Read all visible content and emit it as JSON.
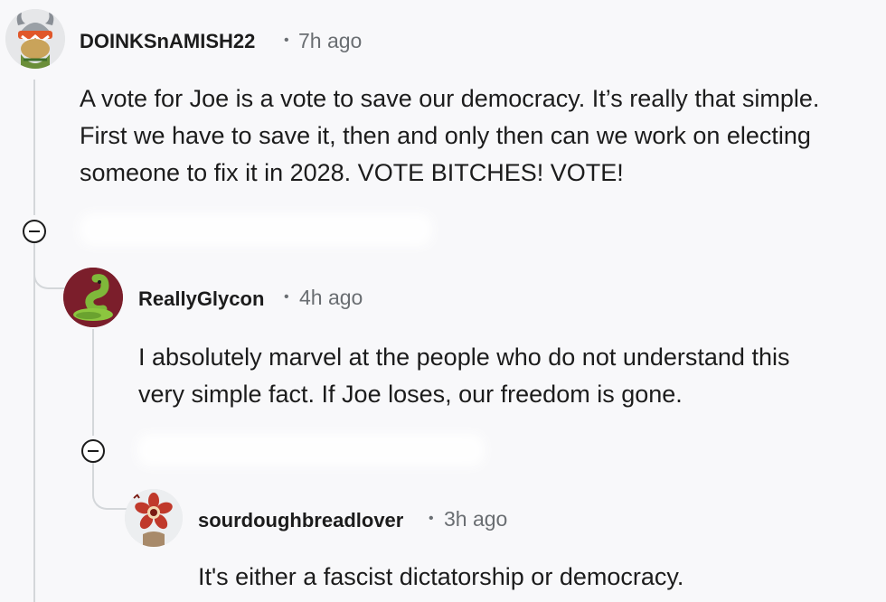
{
  "comments": [
    {
      "username": "DOINKSnAMISH22",
      "separator": "•",
      "time": "7h ago",
      "lines": [
        "A vote for Joe is a vote to save our democracy. It’s really that simple.",
        "First we have to save it, then and only then can we work on electing",
        "someone to fix it in 2028. VOTE BITCHES! VOTE!"
      ],
      "avatar_icon": "viking-snoo-avatar-icon"
    },
    {
      "username": "ReallyGlycon",
      "separator": "•",
      "time": "4h ago",
      "lines": [
        "I absolutely marvel at the people who do not understand this",
        "very simple fact. If Joe loses, our freedom is gone."
      ],
      "avatar_icon": "green-snake-avatar-icon"
    },
    {
      "username": "sourdoughbreadlover",
      "separator": "•",
      "time": "3h ago",
      "lines": [
        "It's either a fascist dictatorship or democracy."
      ],
      "avatar_icon": "demogorgon-avatar-icon"
    }
  ],
  "colors": {
    "background": "#f8f8fa",
    "thread_line": "#d4d7da",
    "meta_text": "#6a6e72",
    "text": "#1c1c1c"
  }
}
